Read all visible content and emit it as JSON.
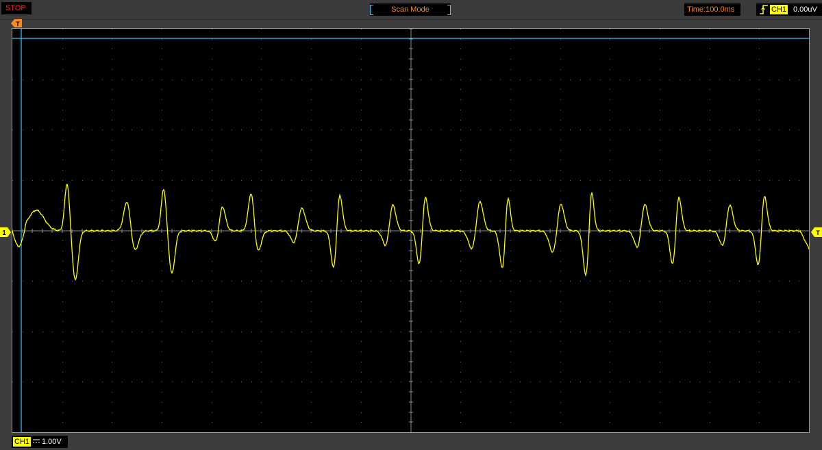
{
  "toolbar": {
    "run_state": "STOP",
    "mode": "Scan Mode",
    "timebase": "Time:100.0ms",
    "trigger": {
      "edge_icon": "rising-edge-icon",
      "channel": "CH1",
      "level": "0.00uV"
    }
  },
  "markers": {
    "trigger_position": "T",
    "channel_ground": "1",
    "trigger_level": "T"
  },
  "bottom": {
    "channel": "CH1",
    "coupling_icon": "dc-coupling-icon",
    "volts_per_div": "1.00V"
  },
  "colors": {
    "background": "#000000",
    "trace_ch1": "#ffff00",
    "cursor": "#39c6ff",
    "marker_orange": "#ff8a1c",
    "stop": "#ff2a2a"
  },
  "display": {
    "grid": "dotted, 16 horizontal x 8 vertical divisions",
    "channel_1_waveform": "periodic biphasic pulses around 0 V"
  }
}
